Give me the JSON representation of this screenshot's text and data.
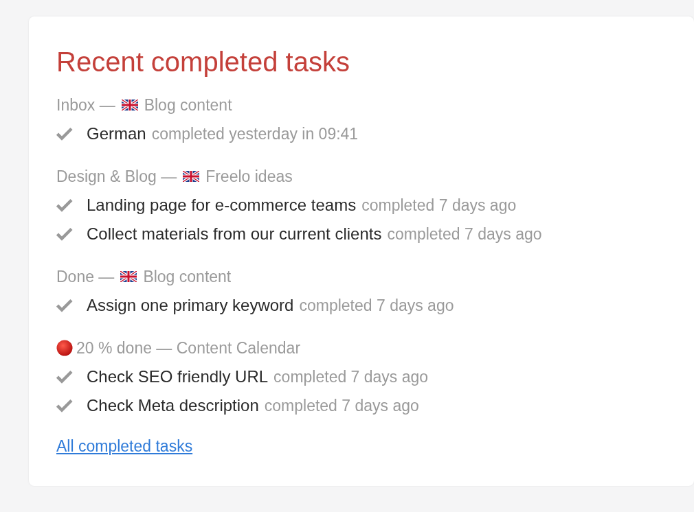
{
  "card": {
    "title": "Recent completed tasks",
    "groups": [
      {
        "kind": "flag",
        "before": "Inbox —",
        "after": "Blog content",
        "tasks": [
          {
            "name": "German",
            "when": "completed yesterday in 09:41"
          }
        ]
      },
      {
        "kind": "flag",
        "before": "Design & Blog —",
        "after": "Freelo ideas",
        "tasks": [
          {
            "name": "Landing page for e-commerce teams",
            "when": "completed 7 days ago"
          },
          {
            "name": "Collect materials from our current clients",
            "when": "completed 7 days ago"
          }
        ]
      },
      {
        "kind": "flag",
        "before": "Done —",
        "after": "Blog content",
        "tasks": [
          {
            "name": "Assign one primary keyword",
            "when": "completed 7 days ago"
          }
        ]
      },
      {
        "kind": "dot",
        "after": "20 % done — Content Calendar",
        "tasks": [
          {
            "name": "Check SEO friendly URL",
            "when": "completed 7 days ago"
          },
          {
            "name": "Check Meta description",
            "when": "completed 7 days ago"
          }
        ]
      }
    ],
    "link": "All completed tasks"
  }
}
